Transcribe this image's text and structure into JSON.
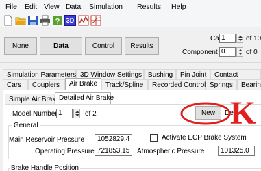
{
  "menu": [
    "File",
    "Edit",
    "View",
    "Data",
    "Simulation",
    "Results",
    "Help"
  ],
  "toolbar_icons": [
    "open-folder-icon",
    "save-icon",
    "print-icon",
    "help-icon",
    "3d-view-icon",
    "chart-icon",
    "grid-chart-icon"
  ],
  "toolbar_3d_label": "3D",
  "mode_buttons": {
    "none": "None",
    "data": "Data",
    "control": "Control",
    "results": "Results"
  },
  "car": {
    "label": "Car",
    "value": "1",
    "of_text": "of 10"
  },
  "component": {
    "label": "Component",
    "value": "0",
    "of_text": "of 0"
  },
  "tabs_row1": [
    "Simulation Parameters",
    "3D Window Settings",
    "Bushing",
    "Pin Joint",
    "Contact"
  ],
  "tabs_row2": [
    "Cars",
    "Couplers",
    "Air Brake",
    "Track/Spline",
    "Recorded Control",
    "Springs",
    "Bearings"
  ],
  "subtabs": [
    "Simple Air Brake",
    "Detailed Air Brake"
  ],
  "model_number": {
    "label": "Model Number",
    "value": "1",
    "of_text": "of 2"
  },
  "new_button": "New",
  "delete_button_partial": "De",
  "general": {
    "title": "General",
    "main_reservoir_label": "Main Reservoir Pressure",
    "main_reservoir_value": "1052829.4",
    "ecp_label": "Activate ECP Brake System",
    "operating_label": "Operating Pressure",
    "operating_value": "721853.15",
    "atmospheric_label": "Atmospheric Pressure",
    "atmospheric_value": "101325.0"
  },
  "brake_handle_title": "Brake Handle Position",
  "annotation": {
    "letter": "K",
    "color": "#e02020"
  }
}
